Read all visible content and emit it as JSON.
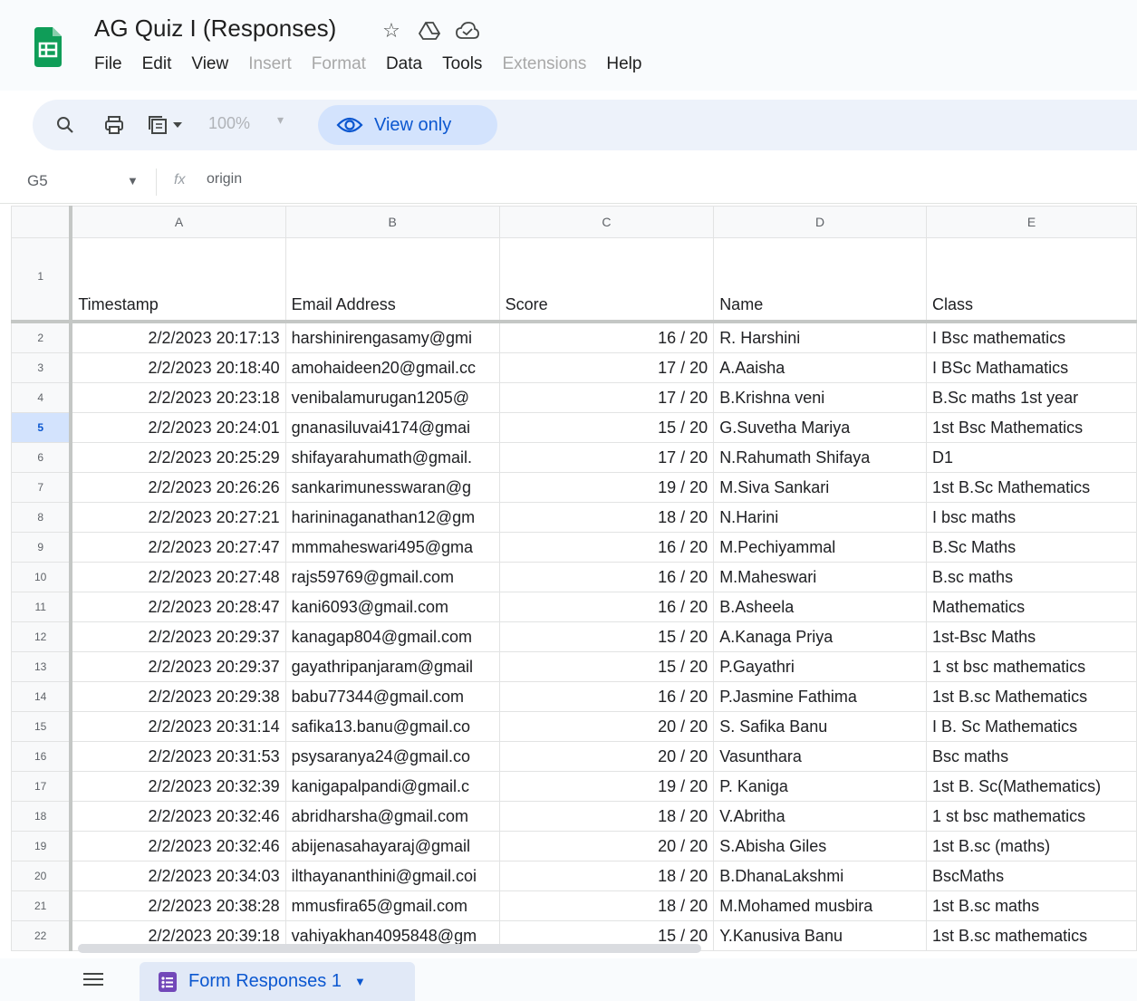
{
  "app": {
    "title": "AG Quiz I  (Responses)",
    "menu": [
      {
        "label": "File",
        "enabled": true
      },
      {
        "label": "Edit",
        "enabled": true
      },
      {
        "label": "View",
        "enabled": true
      },
      {
        "label": "Insert",
        "enabled": false
      },
      {
        "label": "Format",
        "enabled": false
      },
      {
        "label": "Data",
        "enabled": true
      },
      {
        "label": "Tools",
        "enabled": true
      },
      {
        "label": "Extensions",
        "enabled": false
      },
      {
        "label": "Help",
        "enabled": true
      }
    ]
  },
  "toolbar": {
    "zoom": "100%",
    "view_only_label": "View only"
  },
  "formula_bar": {
    "cell_ref": "G5",
    "content": "origin"
  },
  "sheet": {
    "columns": [
      "A",
      "B",
      "C",
      "D",
      "E"
    ],
    "active_row": "5",
    "header": {
      "row": "1",
      "cells": [
        "Timestamp",
        "Email Address",
        "Score",
        "Name",
        "Class"
      ]
    },
    "rows": [
      {
        "row": "2",
        "cells": [
          "2/2/2023 20:17:13",
          "harshinirengasamy@gmi",
          "16 / 20",
          "R. Harshini",
          "I Bsc mathematics"
        ]
      },
      {
        "row": "3",
        "cells": [
          "2/2/2023 20:18:40",
          "amohaideen20@gmail.cc",
          "17 / 20",
          "A.Aaisha",
          "I BSc Mathamatics"
        ]
      },
      {
        "row": "4",
        "cells": [
          "2/2/2023 20:23:18",
          "venibalamurugan1205@",
          "17 / 20",
          "B.Krishna veni",
          "B.Sc maths 1st year"
        ]
      },
      {
        "row": "5",
        "cells": [
          "2/2/2023 20:24:01",
          "gnanasiluvai4174@gmai",
          "15 / 20",
          "G.Suvetha Mariya",
          "1st Bsc Mathematics"
        ]
      },
      {
        "row": "6",
        "cells": [
          "2/2/2023 20:25:29",
          "shifayarahumath@gmail.",
          "17 / 20",
          "N.Rahumath Shifaya",
          "D1"
        ]
      },
      {
        "row": "7",
        "cells": [
          "2/2/2023 20:26:26",
          "sankarimunesswaran@g",
          "19 / 20",
          "M.Siva Sankari",
          "1st B.Sc  Mathematics"
        ]
      },
      {
        "row": "8",
        "cells": [
          "2/2/2023 20:27:21",
          "harininaganathan12@gm",
          "18 / 20",
          "N.Harini",
          "I bsc maths"
        ]
      },
      {
        "row": "9",
        "cells": [
          "2/2/2023 20:27:47",
          "mmmaheswari495@gma",
          "16 / 20",
          "M.Pechiyammal",
          "B.Sc Maths"
        ]
      },
      {
        "row": "10",
        "cells": [
          "2/2/2023 20:27:48",
          "rajs59769@gmail.com",
          "16 / 20",
          "M.Maheswari",
          "B.sc maths"
        ]
      },
      {
        "row": "11",
        "cells": [
          "2/2/2023 20:28:47",
          "kani6093@gmail.com",
          "16 / 20",
          "B.Asheela",
          "Mathematics"
        ]
      },
      {
        "row": "12",
        "cells": [
          "2/2/2023 20:29:37",
          "kanagap804@gmail.com",
          "15 / 20",
          "A.Kanaga Priya",
          "1st-Bsc Maths"
        ]
      },
      {
        "row": "13",
        "cells": [
          "2/2/2023 20:29:37",
          "gayathripanjaram@gmail",
          "15 / 20",
          "P.Gayathri",
          "1 st bsc mathematics"
        ]
      },
      {
        "row": "14",
        "cells": [
          "2/2/2023 20:29:38",
          "babu77344@gmail.com",
          "16 / 20",
          "P.Jasmine Fathima",
          "1st B.sc Mathematics"
        ]
      },
      {
        "row": "15",
        "cells": [
          "2/2/2023 20:31:14",
          "safika13.banu@gmail.co",
          "20 / 20",
          "S. Safika Banu",
          "I B. Sc Mathematics"
        ]
      },
      {
        "row": "16",
        "cells": [
          "2/2/2023 20:31:53",
          "psysaranya24@gmail.co",
          "20 / 20",
          "Vasunthara",
          "Bsc maths"
        ]
      },
      {
        "row": "17",
        "cells": [
          "2/2/2023 20:32:39",
          "kanigapalpandi@gmail.c",
          "19 / 20",
          "P. Kaniga",
          "1st B. Sc(Mathematics)"
        ]
      },
      {
        "row": "18",
        "cells": [
          "2/2/2023 20:32:46",
          "abridharsha@gmail.com",
          "18 / 20",
          "V.Abritha",
          "1 st bsc mathematics"
        ]
      },
      {
        "row": "19",
        "cells": [
          "2/2/2023 20:32:46",
          "abijenasahayaraj@gmail",
          "20 / 20",
          "S.Abisha Giles",
          "1st B.sc (maths)"
        ]
      },
      {
        "row": "20",
        "cells": [
          "2/2/2023 20:34:03",
          "ilthayananthini@gmail.coi",
          "18 / 20",
          "B.DhanaLakshmi",
          "BscMaths"
        ]
      },
      {
        "row": "21",
        "cells": [
          "2/2/2023 20:38:28",
          "mmusfira65@gmail.com",
          "18 / 20",
          "M.Mohamed musbira",
          "1st B.sc maths"
        ]
      },
      {
        "row": "22",
        "cells": [
          "2/2/2023 20:39:18",
          "vahiyakhan4095848@gm",
          "15 / 20",
          "Y.Kanusiva Banu",
          "1st B.sc mathematics"
        ]
      }
    ]
  },
  "tabs": [
    {
      "label": "Form Responses 1",
      "active": true
    }
  ],
  "colors": {
    "accent": "#0b57d0",
    "brand_green": "#0f9d58",
    "selected_bg": "#d3e3fd"
  }
}
